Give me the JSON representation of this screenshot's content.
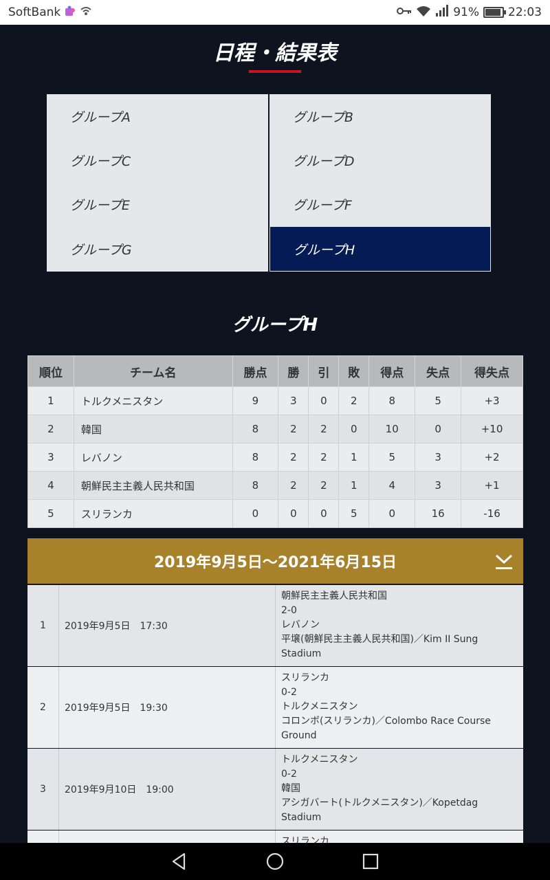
{
  "status_bar": {
    "carrier": "SoftBank",
    "battery_percent": "91%",
    "battery_level": 0.91,
    "time": "22:03",
    "icons": [
      "puzzle-icon",
      "wifi-calling-icon",
      "key-icon",
      "wifi-icon",
      "signal-icon",
      "battery-icon"
    ]
  },
  "page": {
    "title": "日程・結果表",
    "accent_color": "#c8141e"
  },
  "groups": {
    "items": [
      "グループA",
      "グループB",
      "グループC",
      "グループD",
      "グループE",
      "グループF",
      "グループG",
      "グループH"
    ],
    "selected": "グループH",
    "selected_color": "#041b55"
  },
  "group_heading": "グループH",
  "standings": {
    "headers": [
      "順位",
      "チーム名",
      "勝点",
      "勝",
      "引",
      "敗",
      "得点",
      "失点",
      "得失点"
    ],
    "rows": [
      [
        "1",
        "トルクメニスタン",
        "9",
        "3",
        "0",
        "2",
        "8",
        "5",
        "+3"
      ],
      [
        "2",
        "韓国",
        "8",
        "2",
        "2",
        "0",
        "10",
        "0",
        "+10"
      ],
      [
        "3",
        "レバノン",
        "8",
        "2",
        "2",
        "1",
        "5",
        "3",
        "+2"
      ],
      [
        "4",
        "朝鮮民主主義人民共和国",
        "8",
        "2",
        "2",
        "1",
        "4",
        "3",
        "+1"
      ],
      [
        "5",
        "スリランカ",
        "0",
        "0",
        "0",
        "5",
        "0",
        "16",
        "-16"
      ]
    ]
  },
  "schedule": {
    "period": "2019年9月5日～2021年6月15日",
    "header_color": "#a8822b",
    "toggle_icon": "chevron-down-bar-icon",
    "matches": [
      {
        "no": "1",
        "datetime": "2019年9月5日　17:30",
        "home": "朝鮮民主主義人民共和国",
        "score": "2-0",
        "away": "レバノン",
        "venue": "平壌(朝鮮民主主義人民共和国)／Kim II Sung Stadium"
      },
      {
        "no": "2",
        "datetime": "2019年9月5日　19:30",
        "home": "スリランカ",
        "score": "0-2",
        "away": "トルクメニスタン",
        "venue": "コロンボ(スリランカ)／Colombo Race Course Ground"
      },
      {
        "no": "3",
        "datetime": "2019年9月10日　19:00",
        "home": "トルクメニスタン",
        "score": "0-2",
        "away": "韓国",
        "venue": "アシガバート(トルクメニスタン)／Kopetdag Stadium"
      },
      {
        "no": "",
        "datetime": "",
        "home": "スリランカ",
        "score": "",
        "away": "",
        "venue": ""
      }
    ]
  },
  "nav": {
    "icons": [
      "back-icon",
      "home-icon",
      "recents-icon"
    ]
  }
}
